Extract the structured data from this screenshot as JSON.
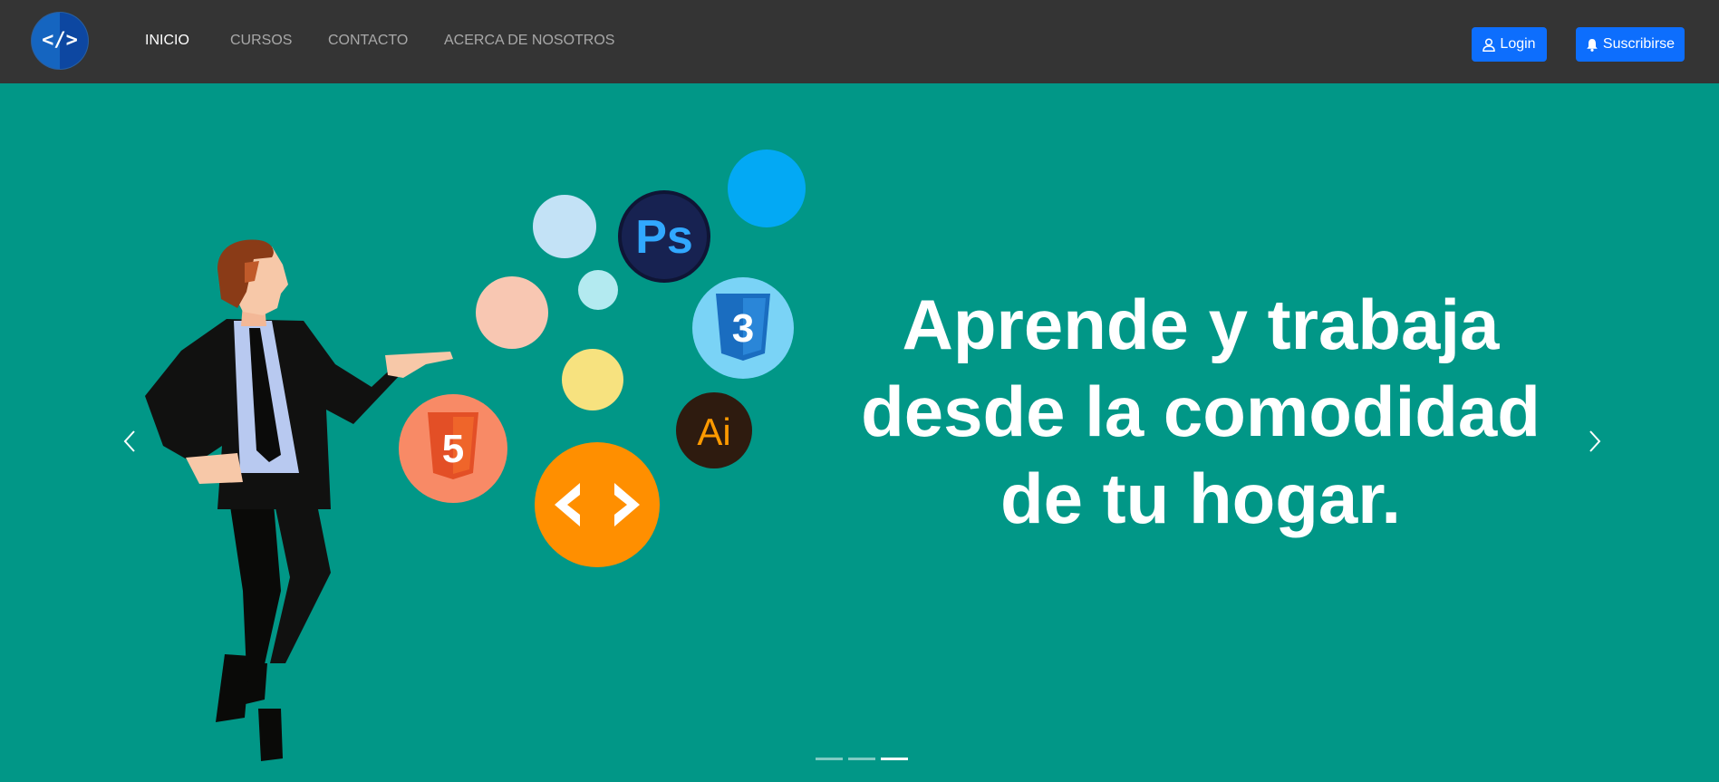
{
  "brand": {
    "logo_text": "</>"
  },
  "nav": {
    "items": [
      {
        "label": "INICIO",
        "active": true
      },
      {
        "label": "CURSOS",
        "active": false
      },
      {
        "label": "CONTACTO",
        "active": false
      },
      {
        "label": "ACERCA DE NOSOTROS",
        "active": false
      }
    ]
  },
  "actions": {
    "login_label": "Login",
    "login_icon": "user-icon",
    "subscribe_label": "Suscribirse",
    "subscribe_icon": "bell-icon"
  },
  "hero": {
    "headline_line1": "Aprende y trabaja",
    "headline_line2": "desde la comodidad",
    "headline_line3": "de tu hogar.",
    "bubble_ps": "Ps",
    "bubble_ai": "Ai",
    "bubble_html": "5",
    "bubble_css": "3",
    "slides_total": 3,
    "active_slide": 3
  },
  "colors": {
    "navbar": "#343434",
    "hero_bg": "#019787",
    "primary_button": "#0d6efd"
  }
}
